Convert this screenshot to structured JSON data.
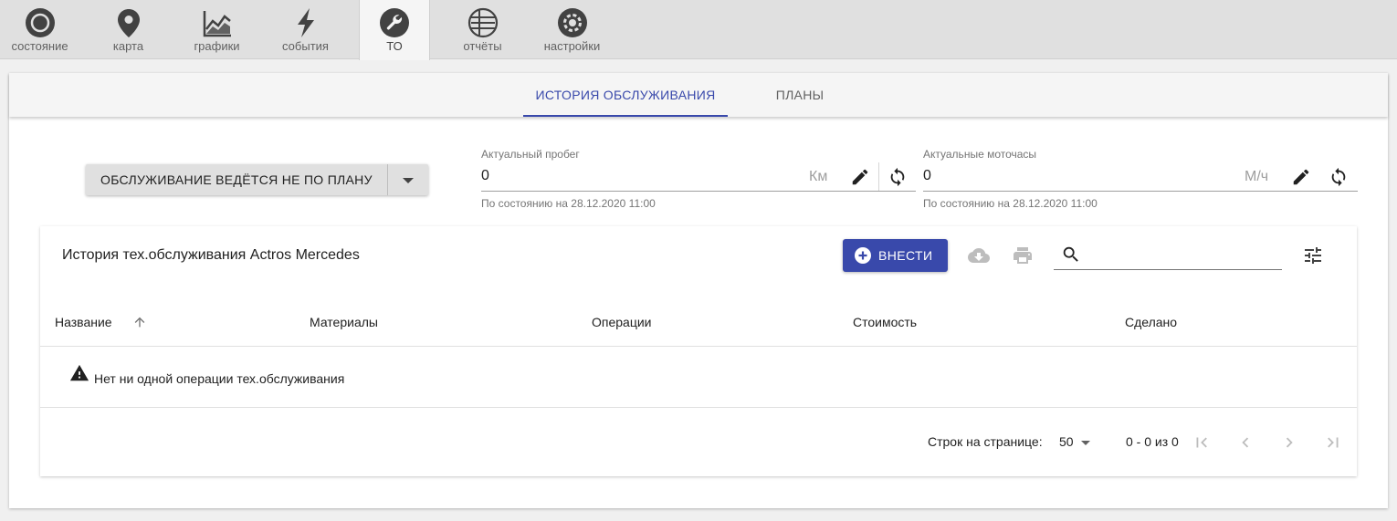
{
  "nav": {
    "items": [
      {
        "label": "состояние",
        "icon": "status-circle-icon"
      },
      {
        "label": "карта",
        "icon": "map-pin-icon"
      },
      {
        "label": "графики",
        "icon": "chart-icon"
      },
      {
        "label": "события",
        "icon": "lightning-icon"
      },
      {
        "label": "ТО",
        "icon": "wrench-icon",
        "active": true
      },
      {
        "label": "отчёты",
        "icon": "report-icon"
      },
      {
        "label": "настройки",
        "icon": "gear-icon"
      }
    ]
  },
  "tabs": {
    "history": "ИСТОРИЯ ОБСЛУЖИВАНИЯ",
    "plans": "ПЛАНЫ",
    "active": "history"
  },
  "mode_button": {
    "label": "ОБСЛУЖИВАНИЕ ВЕДЁТСЯ НЕ ПО ПЛАНУ"
  },
  "mileage": {
    "label": "Актуальный пробег",
    "value": "0",
    "unit": "Км",
    "hint": "По состоянию на 28.12.2020 11:00"
  },
  "motohours": {
    "label": "Актуальные моточасы",
    "value": "0",
    "unit": "М/ч",
    "hint": "По состоянию на 28.12.2020 11:00"
  },
  "history": {
    "title": "История тех.обслуживания Actros Mercedes",
    "add_label": "ВНЕСТИ",
    "search_placeholder": "",
    "columns": [
      "Название",
      "Материалы",
      "Операции",
      "Стоимость",
      "Сделано"
    ],
    "sort_column": "Название",
    "empty_text": "Нет ни одной операции тех.обслуживания"
  },
  "pagination": {
    "rows_label": "Строк на странице:",
    "rows_value": "50",
    "range": "0 - 0 из 0"
  },
  "colors": {
    "accent": "#3949ab",
    "nav_bg": "#e0e0e0",
    "icon": "#424242"
  }
}
